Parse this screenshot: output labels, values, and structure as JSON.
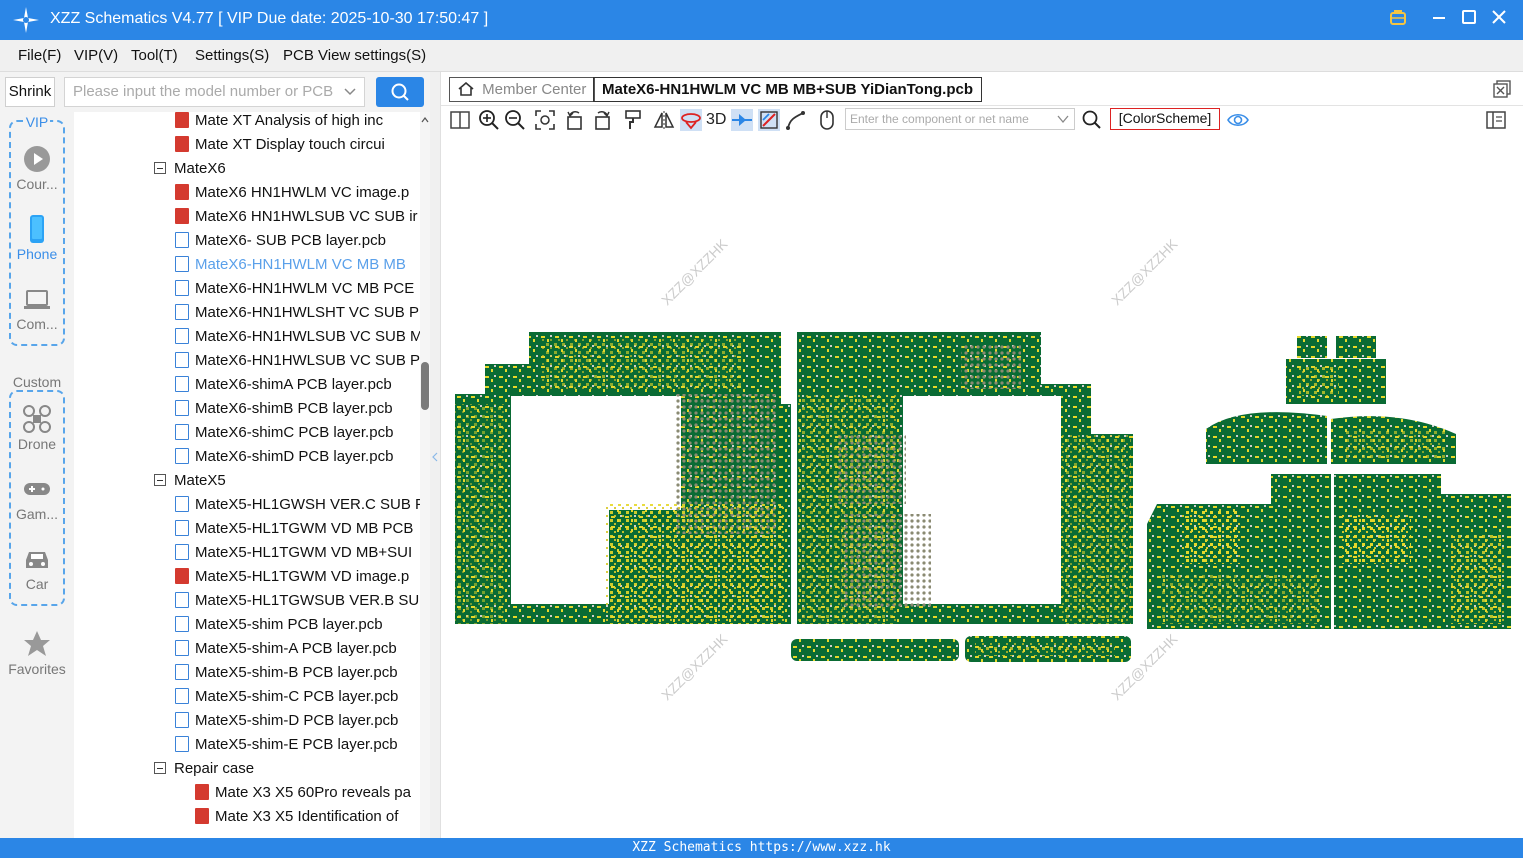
{
  "window": {
    "title": "XZZ Schematics V4.77 [ VIP Due date: 2025-10-30 17:50:47 ]"
  },
  "menu": {
    "items": [
      "File(F)",
      "VIP(V)",
      "Tool(T)",
      "Settings(S)",
      "PCB View settings(S)"
    ]
  },
  "search": {
    "shrink_label": "Shrink",
    "placeholder": "Please input the model number or PCB"
  },
  "nav": {
    "vip_label": "VIP",
    "custom_label": "Custom",
    "items": [
      {
        "label": "Cour...",
        "icon": "play-icon"
      },
      {
        "label": "Phone",
        "icon": "phone-icon"
      },
      {
        "label": "Com...",
        "icon": "laptop-icon"
      },
      {
        "label": "Drone",
        "icon": "drone-icon"
      },
      {
        "label": "Gam...",
        "icon": "gamepad-icon"
      },
      {
        "label": "Car",
        "icon": "car-icon"
      },
      {
        "label": "Favorites",
        "icon": "star-icon"
      }
    ]
  },
  "tree": {
    "rows": [
      {
        "label": "Mate XT Analysis of high inc",
        "type": "pdf",
        "indent": 2
      },
      {
        "label": "Mate XT Display touch circui",
        "type": "pdf",
        "indent": 2
      },
      {
        "label": "MateX6",
        "type": "folder",
        "indent": 1
      },
      {
        "label": "MateX6 HN1HWLM VC image.p",
        "type": "pdf",
        "indent": 2
      },
      {
        "label": "MateX6 HN1HWLSUB VC SUB ir",
        "type": "pdf",
        "indent": 2
      },
      {
        "label": "MateX6- SUB PCB layer.pcb",
        "type": "pcb",
        "indent": 2
      },
      {
        "label": "MateX6-HN1HWLM VC MB MB",
        "type": "pcb",
        "indent": 2,
        "selected": true
      },
      {
        "label": "MateX6-HN1HWLM VC MB PCE",
        "type": "pcb",
        "indent": 2
      },
      {
        "label": "MateX6-HN1HWLSHT VC SUB P",
        "type": "pcb",
        "indent": 2
      },
      {
        "label": "MateX6-HN1HWLSUB VC SUB M",
        "type": "pcb",
        "indent": 2
      },
      {
        "label": "MateX6-HN1HWLSUB VC SUB P",
        "type": "pcb",
        "indent": 2
      },
      {
        "label": "MateX6-shimA PCB layer.pcb",
        "type": "pcb",
        "indent": 2
      },
      {
        "label": "MateX6-shimB PCB layer.pcb",
        "type": "pcb",
        "indent": 2
      },
      {
        "label": "MateX6-shimC PCB layer.pcb",
        "type": "pcb",
        "indent": 2
      },
      {
        "label": "MateX6-shimD PCB layer.pcb",
        "type": "pcb",
        "indent": 2
      },
      {
        "label": "MateX5",
        "type": "folder",
        "indent": 1
      },
      {
        "label": "MateX5-HL1GWSH VER.C SUB P",
        "type": "pcb",
        "indent": 2
      },
      {
        "label": "MateX5-HL1TGWM VD MB PCB",
        "type": "pcb",
        "indent": 2
      },
      {
        "label": "MateX5-HL1TGWM VD MB+SUI",
        "type": "pcb",
        "indent": 2
      },
      {
        "label": "MateX5-HL1TGWM VD image.p",
        "type": "pdf",
        "indent": 2
      },
      {
        "label": "MateX5-HL1TGWSUB VER.B SUE",
        "type": "pcb",
        "indent": 2
      },
      {
        "label": "MateX5-shim PCB layer.pcb",
        "type": "pcb",
        "indent": 2
      },
      {
        "label": "MateX5-shim-A PCB layer.pcb",
        "type": "pcb",
        "indent": 2
      },
      {
        "label": "MateX5-shim-B PCB layer.pcb",
        "type": "pcb",
        "indent": 2
      },
      {
        "label": "MateX5-shim-C PCB layer.pcb",
        "type": "pcb",
        "indent": 2
      },
      {
        "label": "MateX5-shim-D PCB layer.pcb",
        "type": "pcb",
        "indent": 2
      },
      {
        "label": "MateX5-shim-E PCB layer.pcb",
        "type": "pcb",
        "indent": 2
      },
      {
        "label": "Repair case",
        "type": "folder",
        "indent": 1
      },
      {
        "label": "Mate X3 X5 60Pro reveals pa",
        "type": "pdf",
        "indent": 3
      },
      {
        "label": "Mate X3 X5 Identification of",
        "type": "pdf",
        "indent": 3
      }
    ]
  },
  "tabs": {
    "member_center": "Member Center",
    "active_file": "MateX6-HN1HWLM VC MB MB+SUB YiDianTong.pcb"
  },
  "toolbar": {
    "three_d_label": "3D",
    "component_placeholder": "Enter the component or net name",
    "color_scheme_label": "[ColorScheme]"
  },
  "canvas": {
    "watermark": "XZZ@XZZHK"
  },
  "status": {
    "text": "XZZ Schematics https://www.xzz.hk"
  },
  "colors": {
    "accent": "#2b86e6",
    "pcb_green": "#0a6b34",
    "pcb_pad": "#e6d82a",
    "selected_text": "#5aa0ea"
  }
}
